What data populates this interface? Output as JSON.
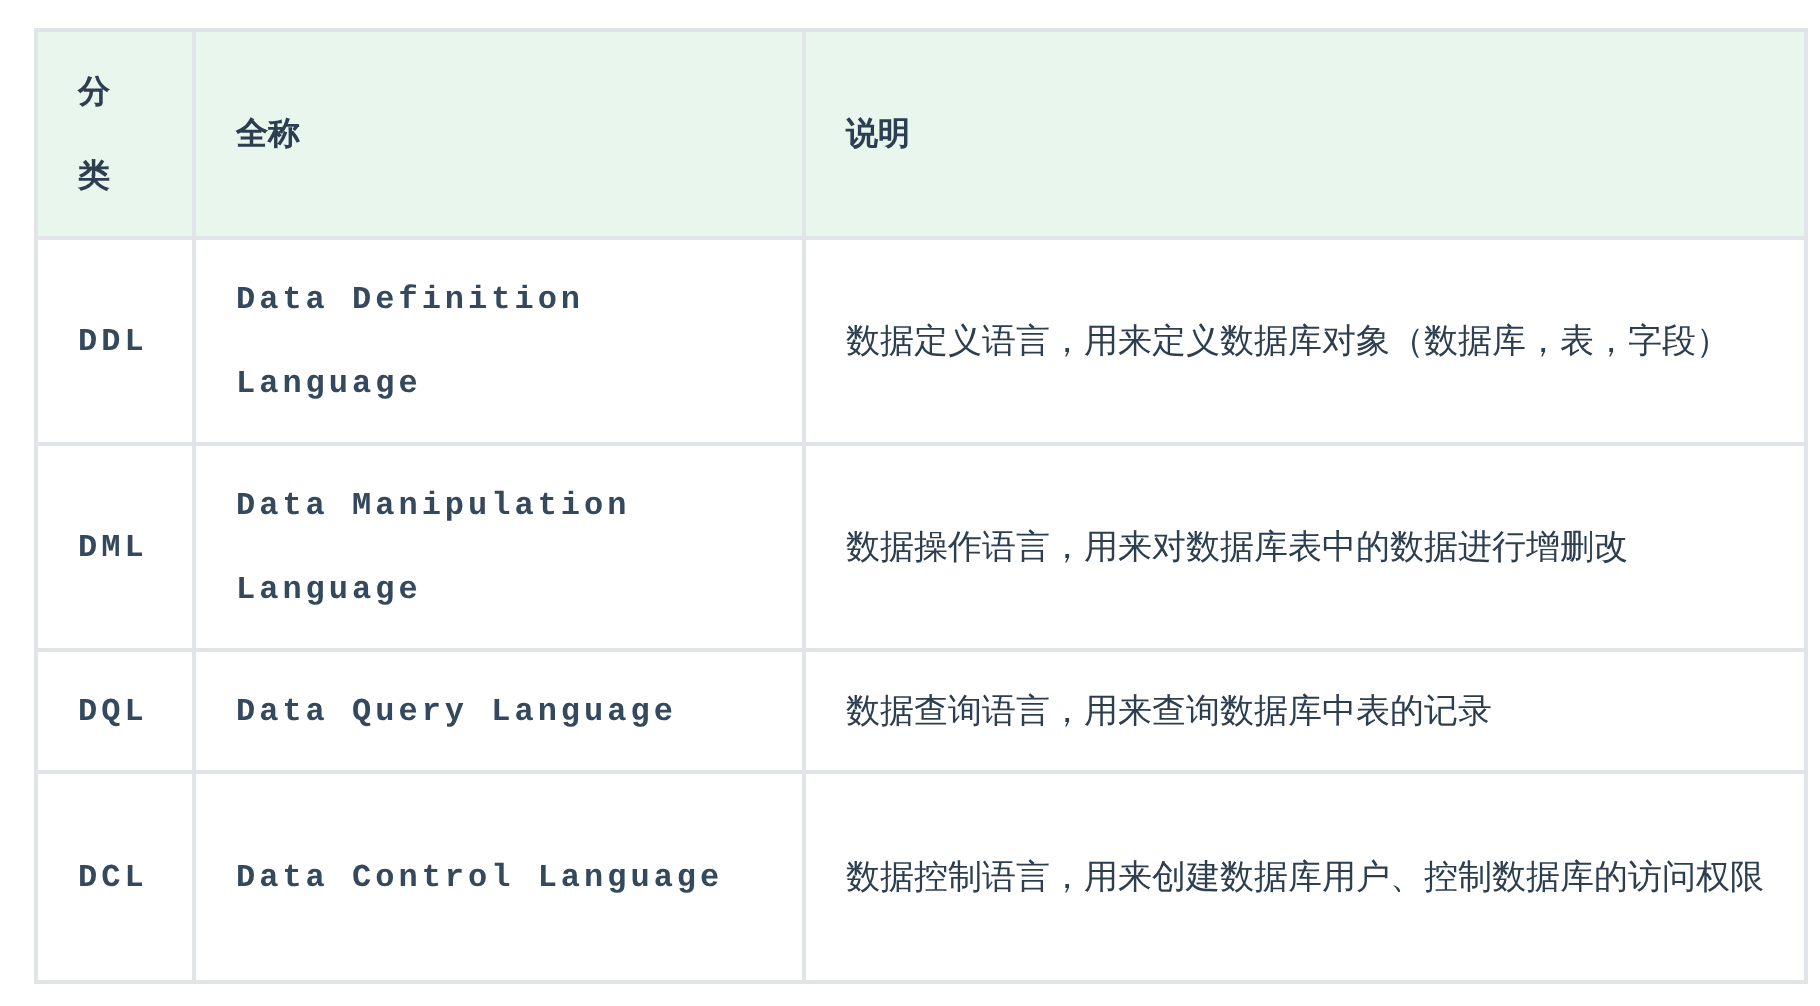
{
  "table": {
    "columns": [
      "分类",
      "全称",
      "说明"
    ],
    "rows": [
      {
        "abbr": "DDL",
        "full_name": "Data Definition Language",
        "description": "数据定义语言，用来定义数据库对象（数据库，表，字段）"
      },
      {
        "abbr": "DML",
        "full_name": "Data Manipulation Language",
        "description": "数据操作语言，用来对数据库表中的数据进行增删改"
      },
      {
        "abbr": "DQL",
        "full_name": "Data Query Language",
        "description": "数据查询语言，用来查询数据库中表的记录"
      },
      {
        "abbr": "DCL",
        "full_name": "Data Control Language",
        "description": "数据控制语言，用来创建数据库用户、控制数据库的访问权限"
      }
    ]
  }
}
